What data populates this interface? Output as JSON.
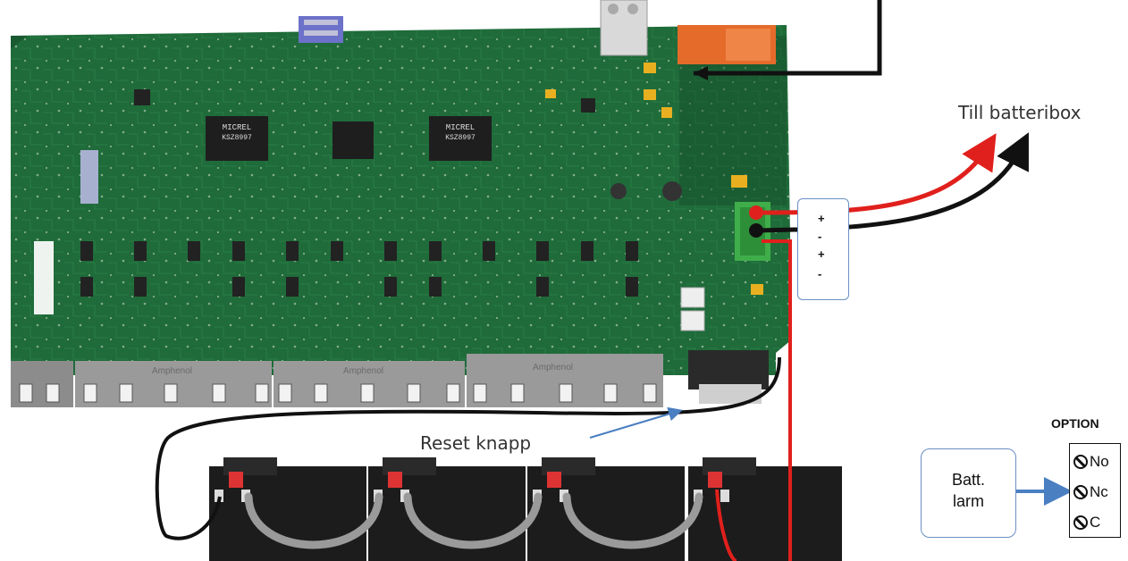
{
  "labels": {
    "till_batteribox": "Till batteribox",
    "reset_knapp": "Reset knapp",
    "option_title": "OPTION"
  },
  "terminal_polarity": [
    "+",
    "-",
    "+",
    "-"
  ],
  "batt_larm": {
    "line1": "Batt.",
    "line2": "larm"
  },
  "option_contacts": [
    "No",
    "Nc",
    "C"
  ],
  "pcb_chips": {
    "chip1": {
      "brand": "MICREL",
      "model": "KSZ8997"
    },
    "chip2": {
      "brand": "MICREL",
      "model": "KSZ8997"
    },
    "connector_brand": "Amphenol"
  },
  "colors": {
    "pcb": "#1f6b3a",
    "wire_red": "#e0201c",
    "wire_black": "#111111",
    "arrow_blue": "#4a7fc1",
    "battery": "#1c1c1c"
  }
}
